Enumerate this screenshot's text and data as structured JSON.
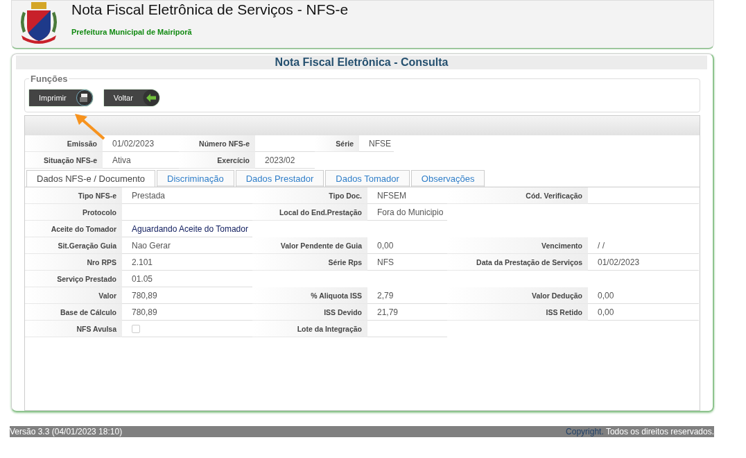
{
  "header": {
    "title": "Nota Fiscal Eletrônica de Serviços - NFS-e",
    "subtitle": "Prefeitura Municipal de Mairiporã"
  },
  "page_title": "Nota Fiscal Eletrônica - Consulta",
  "functions": {
    "legend": "Funções",
    "buttons": [
      {
        "label": "Imprimir",
        "kind": "print"
      },
      {
        "label": "Voltar",
        "kind": "back"
      }
    ]
  },
  "summary": [
    [
      {
        "label": "Emissão",
        "value": "01/02/2023"
      },
      {
        "label": "Número NFS-e"
      },
      {
        "label": "Série",
        "value": "NFSE"
      }
    ],
    [
      {
        "label": "Situação NFS-e",
        "value": "Ativa"
      },
      {
        "label": "Exercício",
        "value": "2023/02"
      }
    ]
  ],
  "tabs": [
    {
      "label": "Dados NFS-e / Documento",
      "selected": true
    },
    {
      "label": "Discriminação",
      "selected": false
    },
    {
      "label": "Dados Prestador",
      "selected": false
    },
    {
      "label": "Dados Tomador",
      "selected": false
    },
    {
      "label": "Observações",
      "selected": false
    }
  ],
  "details": [
    [
      {
        "label": "Tipo NFS-e",
        "value": "Prestada"
      },
      {
        "label": "Tipo Doc.",
        "value": "NFSEM"
      },
      {
        "label": "Cód. Verificação"
      }
    ],
    [
      {
        "label": "Protocolo"
      },
      {
        "label": "Local do End.Prestação",
        "value": "Fora do Municipio"
      }
    ],
    [
      {
        "label": "Aceite do Tomador",
        "value": "Aguardando Aceite do Tomador",
        "kind": "highlight"
      }
    ],
    [
      {
        "label": "Sit.Geração Guia",
        "value": "Nao Gerar"
      },
      {
        "label": "Valor Pendente de Guia",
        "value": "0,00"
      },
      {
        "label": "Vencimento",
        "value": "/ /"
      }
    ],
    [
      {
        "label": "Nro RPS",
        "value": "2.101"
      },
      {
        "label": "Série Rps",
        "value": "NFS"
      },
      {
        "label": "Data da Prestação de Serviços",
        "value": "01/02/2023"
      }
    ],
    [
      {
        "label": "Serviço Prestado",
        "value": "01.05"
      }
    ],
    [
      {
        "label": "Valor",
        "value": "780,89"
      },
      {
        "label": "% Aliquota ISS",
        "value": "2,79"
      },
      {
        "label": "Valor Dedução",
        "value": "0,00"
      }
    ],
    [
      {
        "label": "Base de Cálculo",
        "value": "780,89"
      },
      {
        "label": "ISS Devido",
        "value": "21,79"
      },
      {
        "label": "ISS Retido",
        "value": "0,00"
      }
    ],
    [
      {
        "label": "NFS Avulsa",
        "kind": "checkbox",
        "checked": false
      },
      {
        "label": "Lote da Integração"
      }
    ]
  ],
  "footer": {
    "version": "Versão 3.3 (04/01/2023 18:10)",
    "link": "Copyright.",
    "rights": "Todos os direitos reservados."
  }
}
